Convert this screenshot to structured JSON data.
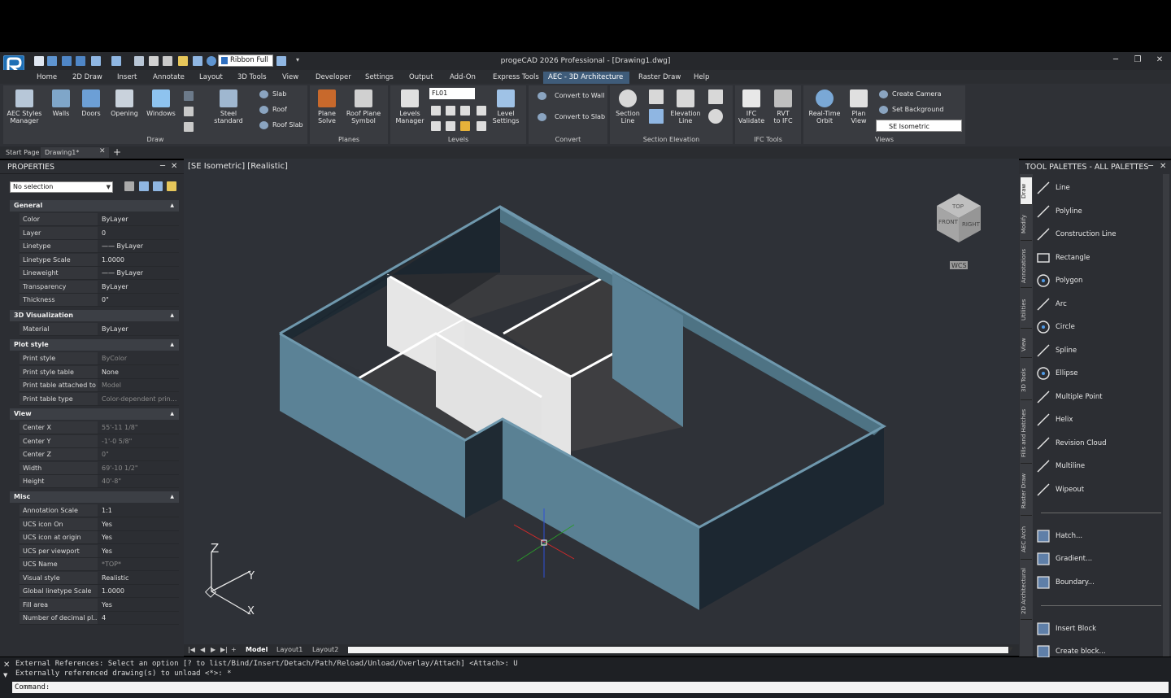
{
  "window": {
    "title": "progeCAD 2026 Professional - [Drawing1.dwg]",
    "workspace_button": "Ribbon Full"
  },
  "tabs": [
    "Home",
    "2D Draw",
    "Insert",
    "Annotate",
    "Layout",
    "3D Tools",
    "View",
    "Developer",
    "Settings",
    "Output",
    "Add-On",
    "Express Tools",
    "AEC - 3D Architecture",
    "Raster Draw",
    "Help"
  ],
  "ribbon": {
    "aec_styles": "AEC Styles\nManager",
    "walls": "Walls",
    "doors": "Doors",
    "opening": "Opening",
    "windows": "Windows",
    "steel": "Steel\nstandard",
    "slab": "Slab",
    "roof": "Roof",
    "roof_slab": "Roof Slab",
    "draw_panel": "Draw",
    "plane_solve": "Plane\nSolve",
    "roof_plane_symbol": "Roof Plane\nSymbol",
    "planes_panel": "Planes",
    "levels_manager": "Levels\nManager",
    "level_value": "FL01",
    "level_settings": "Level\nSettings",
    "levels_panel": "Levels",
    "convert_to_wall": "Convert to Wall",
    "convert_to_slab": "Convert to Slab",
    "convert_panel": "Convert",
    "section_line": "Section\nLine",
    "elevation_line": "Elevation\nLine",
    "section_elevation_panel": "Section  Elevation",
    "ifc_validate": "IFC\nValidate",
    "rvt_to_ifc": "RVT\nto IFC",
    "ifc_panel": "IFC Tools",
    "realtime_orbit": "Real-Time\nOrbit",
    "plan_view": "Plan\nView",
    "create_camera": "Create Camera",
    "set_background": "Set Background",
    "view_select": "SE Isometric",
    "views_panel": "Views"
  },
  "doc_tabs": [
    "Start Page",
    "Drawing1*"
  ],
  "properties": {
    "title": "PROPERTIES",
    "selection": "No selection",
    "sections": [
      {
        "name": "General",
        "rows": [
          [
            "Color",
            "ByLayer"
          ],
          [
            "Layer",
            "0"
          ],
          [
            "Linetype",
            "—— ByLayer"
          ],
          [
            "Linetype Scale",
            "1.0000"
          ],
          [
            "Lineweight",
            "—— ByLayer"
          ],
          [
            "Transparency",
            "ByLayer"
          ],
          [
            "Thickness",
            "0\""
          ]
        ]
      },
      {
        "name": "3D Visualization",
        "rows": [
          [
            "Material",
            "ByLayer"
          ]
        ]
      },
      {
        "name": "Plot style",
        "rows": [
          [
            "Print style",
            "ByColor"
          ],
          [
            "Print style table",
            "None"
          ],
          [
            "Print table attached to",
            "Model"
          ],
          [
            "Print table type",
            "Color-dependent prin..."
          ]
        ]
      },
      {
        "name": "View",
        "rows": [
          [
            "Center X",
            "55'-11 1/8\""
          ],
          [
            "Center Y",
            "-1'-0 5/8\""
          ],
          [
            "Center Z",
            "0\""
          ],
          [
            "Width",
            "69'-10 1/2\""
          ],
          [
            "Height",
            "40'-8\""
          ]
        ]
      },
      {
        "name": "Misc",
        "rows": [
          [
            "Annotation Scale",
            "1:1"
          ],
          [
            "UCS icon On",
            "Yes"
          ],
          [
            "UCS icon at origin",
            "Yes"
          ],
          [
            "UCS per viewport",
            "Yes"
          ],
          [
            "UCS Name",
            "*TOP*"
          ],
          [
            "Visual style",
            "Realistic"
          ],
          [
            "Global linetype Scale",
            "1.0000"
          ],
          [
            "Fill area",
            "Yes"
          ],
          [
            "Number of decimal pl...",
            "4"
          ]
        ]
      }
    ]
  },
  "viewport": {
    "label": "[SE Isometric] [Realistic]",
    "wcs": "WCS",
    "cube_top": "TOP",
    "cube_front": "FRONT",
    "cube_right": "RIGHT",
    "axis_x": "X",
    "axis_y": "Y",
    "axis_z": "Z"
  },
  "layout_tabs": [
    "Model",
    "Layout1",
    "Layout2"
  ],
  "tool_palette": {
    "title": "TOOL PALETTES - ALL PALETTES",
    "vtabs": [
      "Draw",
      "Modify",
      "Annotations",
      "Utilities",
      "View",
      "3D Tools",
      "Fills and Hatches",
      "Raster Draw",
      "AEC Arch",
      "2D Architectural"
    ],
    "tools": [
      "Line",
      "Polyline",
      "Construction Line",
      "Rectangle",
      "Polygon",
      "Arc",
      "Circle",
      "Spline",
      "Ellipse",
      "Multiple Point",
      "Helix",
      "Revision Cloud",
      "Multiline",
      "Wipeout",
      "Hatch...",
      "Gradient...",
      "Boundary...",
      "Insert Block",
      "Create block..."
    ]
  },
  "command": {
    "line1": "External References: Select an option [? to list/Bind/Insert/Detach/Path/Reload/Unload/Overlay/Attach] <Attach>: U",
    "line2": "Externally referenced drawing(s) to unload <*>: *",
    "prompt": "Command:"
  },
  "colors": {
    "accent": "#3f5c7a",
    "wall_outer": "#5a8194",
    "wall_inner": "#3f3f42",
    "wall_white": "#e8e8e8"
  }
}
